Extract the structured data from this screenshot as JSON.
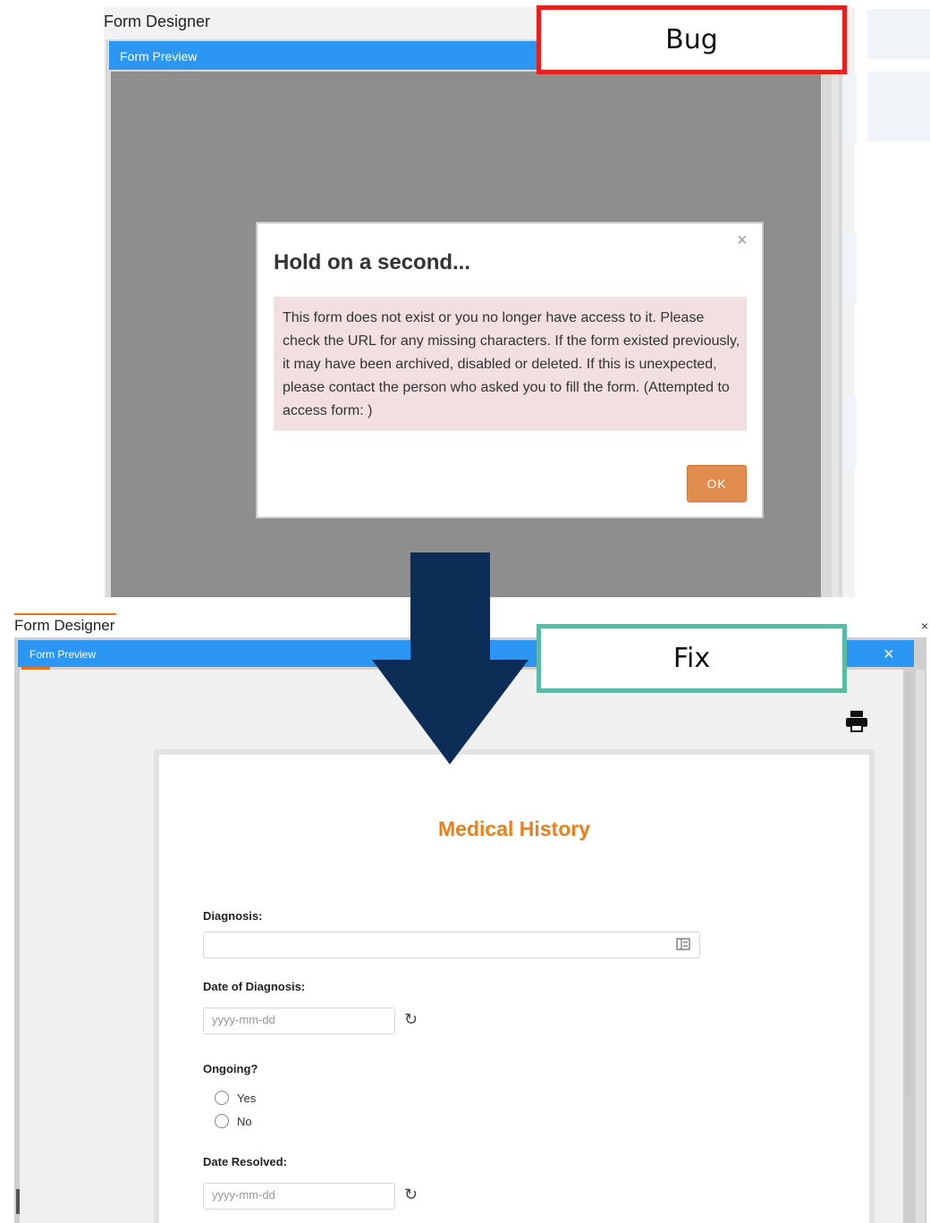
{
  "bug_panel": {
    "app_title": "Form Designer",
    "window_title": "Form Preview",
    "modal": {
      "close_glyph": "×",
      "heading": "Hold on a second...",
      "message": "This form does not exist or you no longer have access to it. Please check the URL for any missing characters. If the form existed previously, it may have been archived, disabled or deleted. If this is unexpected, please contact the person who asked you to fill the form. (Attempted to access form: )",
      "ok_label": "OK"
    },
    "annotation": "Bug",
    "annotation_color": "#e81f1f"
  },
  "fix_panel": {
    "app_title": "Form Designer",
    "window_title": "Form Preview",
    "close_glyph": "×",
    "outer_close_glyph": "×",
    "annotation": "Fix",
    "annotation_color": "#5fb8a4",
    "print_icon": "printer-icon",
    "form": {
      "title": "Medical History",
      "title_color": "#e8801f",
      "diagnosis_label": "Diagnosis:",
      "diagnosis_value": "",
      "diagnosis_icon": "list-picker-icon",
      "date_of_diagnosis_label": "Date of Diagnosis:",
      "date_of_diagnosis_placeholder": "yyyy-mm-dd",
      "ongoing_label": "Ongoing?",
      "ongoing_options": [
        "Yes",
        "No"
      ],
      "date_resolved_label": "Date Resolved:",
      "date_resolved_placeholder": "yyyy-mm-dd",
      "refresh_icon": "refresh-icon"
    }
  },
  "arrow": {
    "color": "#0c2d55",
    "direction": "down"
  }
}
